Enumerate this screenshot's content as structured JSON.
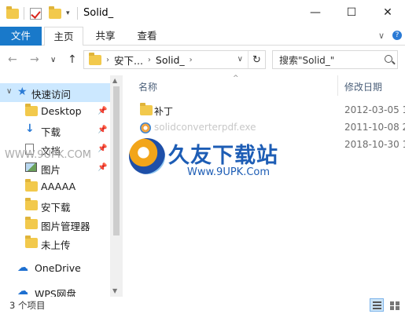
{
  "window": {
    "title": "Solid_",
    "minimize": "—",
    "maximize": "☐",
    "close": "✕"
  },
  "ribbon": {
    "tabs": [
      "文件",
      "主页",
      "共享",
      "查看"
    ],
    "expand": "∨",
    "help": "?"
  },
  "address": {
    "back": "←",
    "forward": "→",
    "recent": "∨",
    "up": "↑",
    "crumbs": [
      "安下...",
      "Solid_"
    ],
    "refresh": "↻",
    "search_placeholder": "搜索\"Solid_\""
  },
  "nav": {
    "quick_access": "快速访问",
    "items": [
      {
        "label": "Desktop",
        "pinned": true,
        "icon": "folder-icon"
      },
      {
        "label": "下载",
        "pinned": true,
        "icon": "download-icon"
      },
      {
        "label": "文档",
        "pinned": true,
        "icon": "document-icon"
      },
      {
        "label": "图片",
        "pinned": true,
        "icon": "picture-icon"
      },
      {
        "label": "AAAAA",
        "pinned": false,
        "icon": "folder-icon"
      },
      {
        "label": "安下载",
        "pinned": false,
        "icon": "folder-icon"
      },
      {
        "label": "图片管理器",
        "pinned": false,
        "icon": "folder-icon"
      },
      {
        "label": "未上传",
        "pinned": false,
        "icon": "folder-icon"
      }
    ],
    "onedrive": "OneDrive",
    "wps": "WPS网盘"
  },
  "columns": {
    "name": "名称",
    "modified": "修改日期"
  },
  "files": [
    {
      "name": "补丁",
      "date": "2012-03-05 1",
      "type": "folder"
    },
    {
      "name": "solidconverterpdf.exe",
      "date": "2011-10-08 2",
      "type": "exe"
    },
    {
      "name": "",
      "date": "2018-10-30 1",
      "type": "blank"
    }
  ],
  "watermark": {
    "title": "久友下载站",
    "url": "Www.9UPK.Com",
    "side": "WWW.9UPK.COM"
  },
  "status": {
    "count": "3 个项目"
  },
  "colors": {
    "accent": "#1979ca",
    "selection": "#cce8ff",
    "folder": "#f2c94c"
  }
}
